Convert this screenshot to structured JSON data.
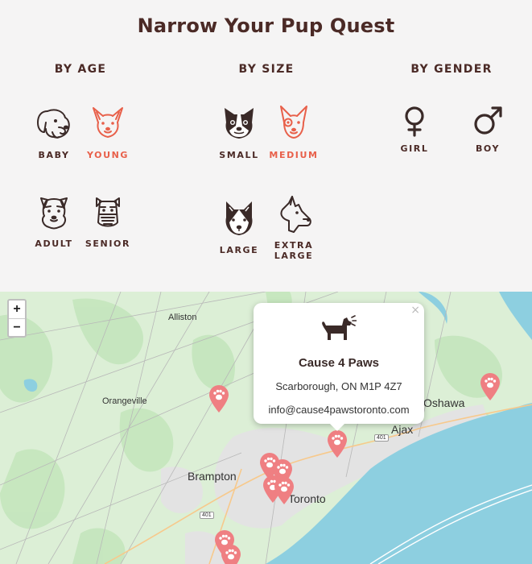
{
  "page": {
    "title": "Narrow Your Pup Quest"
  },
  "filters": {
    "age": {
      "heading": "BY AGE",
      "options": [
        {
          "label": "BABY",
          "icon": "puppy-face-icon",
          "active": false
        },
        {
          "label": "YOUNG",
          "icon": "young-dog-face-icon",
          "active": true
        },
        {
          "label": "ADULT",
          "icon": "adult-dog-face-icon",
          "active": false
        },
        {
          "label": "SENIOR",
          "icon": "senior-dog-face-icon",
          "active": false
        }
      ]
    },
    "size": {
      "heading": "BY SIZE",
      "options": [
        {
          "label": "SMALL",
          "icon": "boston-terrier-icon",
          "active": false
        },
        {
          "label": "MEDIUM",
          "icon": "bull-terrier-icon",
          "active": true
        },
        {
          "label": "LARGE",
          "icon": "husky-icon",
          "active": false
        },
        {
          "label": "EXTRA LARGE",
          "icon": "great-dane-icon",
          "active": false
        }
      ]
    },
    "gender": {
      "heading": "BY GENDER",
      "options": [
        {
          "label": "GIRL",
          "icon": "female-symbol-icon"
        },
        {
          "label": "BOY",
          "icon": "male-symbol-icon"
        }
      ]
    }
  },
  "colors": {
    "brown": "#4b2a26",
    "accent": "#e8604a",
    "water": "#8dcfe0",
    "land": "#dff0d8",
    "pin": "#ef7f82"
  },
  "map": {
    "zoom_in": "+",
    "zoom_out": "−",
    "places": [
      "Alliston",
      "Orangeville",
      "Brampton",
      "Toronto",
      "Ajax",
      "Oshawa"
    ],
    "highways": [
      "401",
      "401"
    ],
    "popup": {
      "close": "×",
      "icon": "barking-dog-icon",
      "name": "Cause 4 Paws",
      "address": "Scarborough, ON M1P 4Z7",
      "email": "info@cause4pawstoronto.com"
    }
  }
}
